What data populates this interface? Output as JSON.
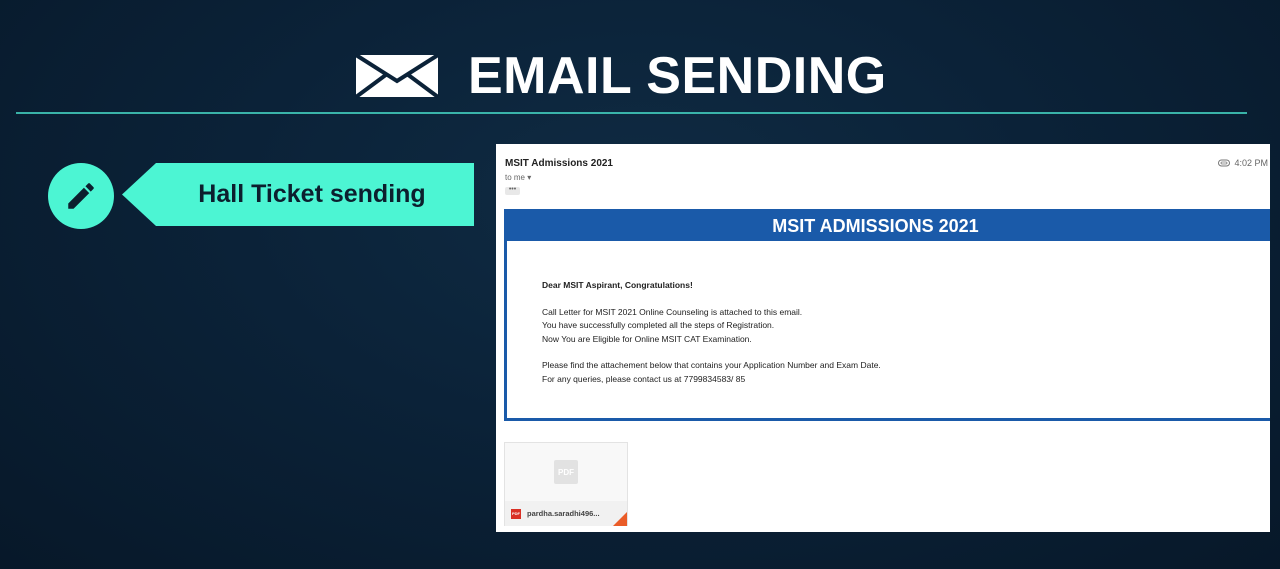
{
  "header": {
    "title": "EMAIL SENDING",
    "icon": "envelope-icon"
  },
  "tag": {
    "label": "Hall Ticket sending",
    "icon": "pencil-icon",
    "color": "#4cf5d3"
  },
  "email": {
    "sender": "MSIT Admissions 2021",
    "to": "to me ▾",
    "time": "4:02 PM",
    "ellipsis": "•••",
    "banner": "MSIT ADMISSIONS 2021",
    "banner_color": "#1a5aa9",
    "greeting": "Dear MSIT Aspirant, Congratulations!",
    "lines": [
      "Call Letter for MSIT 2021 Online Counseling is attached to this email.",
      "You have successfully completed all the steps of Registration.",
      "Now You are Eligible for Online MSIT CAT Examination.",
      "Please find the attachement below that contains your Application Number and Exam Date.",
      "For any queries, please contact us at 7799834583/ 85"
    ],
    "attachment": {
      "preview_label": "PDF",
      "badge": "PDF",
      "name": "pardha.saradhi496..."
    }
  }
}
